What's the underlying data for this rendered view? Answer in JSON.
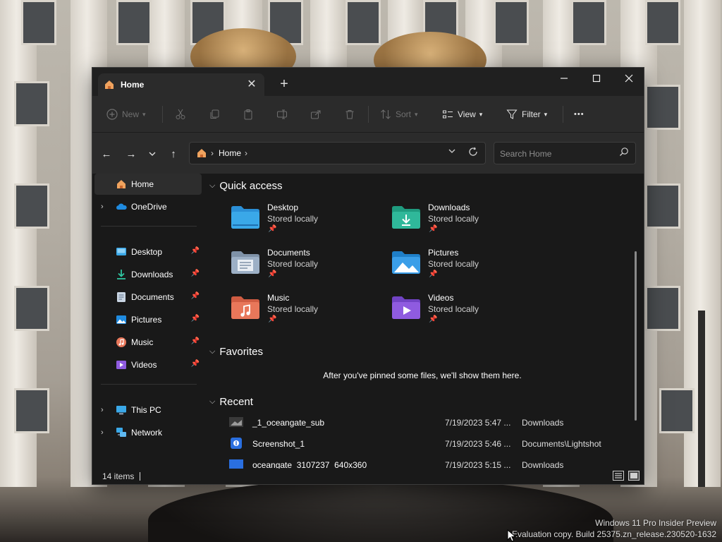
{
  "window": {
    "tab_title": "Home",
    "tab_close": "✕",
    "new_tab": "+",
    "minimize": "—",
    "maximize": "☐",
    "close": "✕"
  },
  "toolbar": {
    "new_label": "New",
    "sort_label": "Sort",
    "view_label": "View",
    "filter_label": "Filter",
    "more": "•••"
  },
  "navbar": {
    "back": "←",
    "forward": "→",
    "recent": "⌄",
    "up": "↑",
    "address_crumb": "Home",
    "search_placeholder": "Search Home"
  },
  "sidebar": {
    "home": "Home",
    "onedrive": "OneDrive",
    "pinned": [
      {
        "label": "Desktop",
        "icon": "desktop-folder-icon"
      },
      {
        "label": "Downloads",
        "icon": "downloads-folder-icon"
      },
      {
        "label": "Documents",
        "icon": "documents-folder-icon"
      },
      {
        "label": "Pictures",
        "icon": "pictures-folder-icon"
      },
      {
        "label": "Music",
        "icon": "music-folder-icon"
      },
      {
        "label": "Videos",
        "icon": "videos-folder-icon"
      }
    ],
    "this_pc": "This PC",
    "network": "Network"
  },
  "main": {
    "quick_access_title": "Quick access",
    "quick_access": [
      {
        "name": "Desktop",
        "sub": "Stored locally",
        "color": "#3aa8e8"
      },
      {
        "name": "Downloads",
        "sub": "Stored locally",
        "color": "#2fb89a"
      },
      {
        "name": "Documents",
        "sub": "Stored locally",
        "color": "#9db0c6"
      },
      {
        "name": "Pictures",
        "sub": "Stored locally",
        "color": "#3a9ee8"
      },
      {
        "name": "Music",
        "sub": "Stored locally",
        "color": "#e8775a"
      },
      {
        "name": "Videos",
        "sub": "Stored locally",
        "color": "#8f5be0"
      }
    ],
    "favorites_title": "Favorites",
    "favorites_empty": "After you've pinned some files, we'll show them here.",
    "recent_title": "Recent",
    "recent": [
      {
        "name": "_1_oceangate_sub",
        "date": "7/19/2023 5:47 ...",
        "location": "Downloads"
      },
      {
        "name": "Screenshot_1",
        "date": "7/19/2023 5:46 ...",
        "location": "Documents\\Lightshot"
      },
      {
        "name": "oceangate_3107237_640x360",
        "date": "7/19/2023 5:15 ...",
        "location": "Downloads"
      }
    ]
  },
  "status": {
    "item_count": "14 items"
  },
  "watermark": {
    "line1": "Windows 11 Pro Insider Preview",
    "line2": "Evaluation copy. Build 25375.zn_release.230520-1632"
  }
}
